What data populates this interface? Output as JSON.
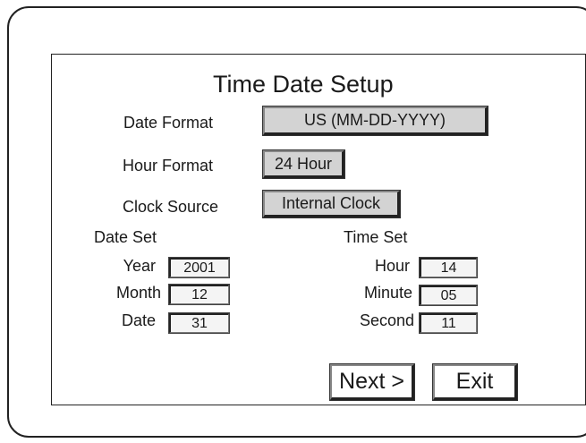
{
  "title": "Time Date Setup",
  "date_format": {
    "label": "Date Format",
    "value": "US (MM-DD-YYYY)"
  },
  "hour_format": {
    "label": "Hour Format",
    "value": "24 Hour"
  },
  "clock_source": {
    "label": "Clock Source",
    "value": "Internal Clock"
  },
  "date_set": {
    "heading": "Date Set",
    "year": {
      "label": "Year",
      "value": "2001"
    },
    "month": {
      "label": "Month",
      "value": "12"
    },
    "date": {
      "label": "Date",
      "value": "31"
    }
  },
  "time_set": {
    "heading": "Time Set",
    "hour": {
      "label": "Hour",
      "value": "14"
    },
    "minute": {
      "label": "Minute",
      "value": "05"
    },
    "second": {
      "label": "Second",
      "value": "11"
    }
  },
  "buttons": {
    "next": "Next >",
    "exit": "Exit"
  }
}
